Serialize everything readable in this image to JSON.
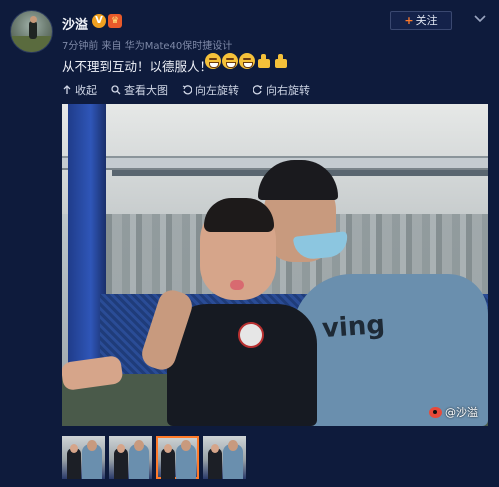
{
  "post": {
    "username": "沙溢",
    "badge_v": "V",
    "badge_crown": "♛",
    "meta": "7分钟前 来自 华为Mate40保时捷设计",
    "follow_label": "关注",
    "follow_plus": "+",
    "text": "从不理到互动！以德服人！",
    "emojis": [
      "grin-emoji",
      "grin-emoji",
      "grin-emoji",
      "thumbs-up-emoji",
      "thumbs-up-emoji"
    ]
  },
  "toolbar": {
    "collapse": "收起",
    "view_large": "查看大图",
    "rotate_left": "向左旋转",
    "rotate_right": "向右旋转"
  },
  "photo": {
    "watermark": "@沙溢",
    "shirt_text": "ving"
  },
  "thumbnails": {
    "count": 4,
    "selected_index": 2
  },
  "colors": {
    "background": "#0e1b3c",
    "accent": "#ff7a2a",
    "badge_v": "#f0a020"
  }
}
